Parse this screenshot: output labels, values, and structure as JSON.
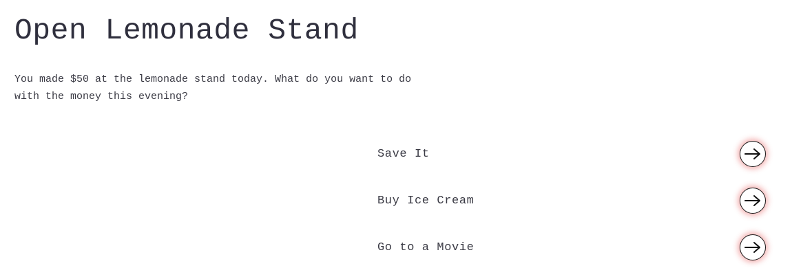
{
  "page": {
    "title": "Open Lemonade Stand",
    "intro": "You made $50 at the lemonade stand today. What do you want to do with the money this evening?"
  },
  "choices": [
    {
      "label": "Save It",
      "icon": "arrow-right-icon"
    },
    {
      "label": "Buy Ice Cream",
      "icon": "arrow-right-icon"
    },
    {
      "label": "Go to a Movie",
      "icon": "arrow-right-icon"
    }
  ],
  "colors": {
    "text": "#2f2f3d",
    "button_border": "#1a1a1a",
    "button_glow": "#e65a5a"
  }
}
